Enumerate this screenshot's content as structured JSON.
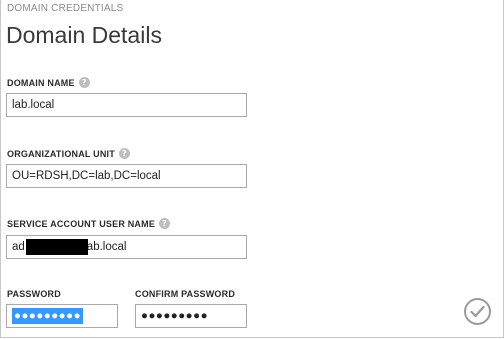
{
  "header": {
    "section_label": "DOMAIN CREDENTIALS",
    "title": "Domain Details"
  },
  "form": {
    "domain_name": {
      "label": "DOMAIN NAME",
      "value": "lab.local"
    },
    "organizational_unit": {
      "label": "ORGANIZATIONAL UNIT",
      "value": "OU=RDSH,DC=lab,DC=local"
    },
    "service_account": {
      "label": "SERVICE ACCOUNT USER NAME",
      "value_prefix": "ad",
      "value_suffix": "ab.local"
    },
    "password": {
      "label": "PASSWORD",
      "masked_value": "●●●●●●●●●"
    },
    "confirm_password": {
      "label": "CONFIRM PASSWORD",
      "masked_value": "●●●●●●●●●"
    }
  },
  "icons": {
    "help": "help-question-icon",
    "ok": "checkmark-icon"
  },
  "colors": {
    "selection": "#3399ff",
    "input_border": "#a9a9a9",
    "help_icon": "#bdbdbd"
  }
}
